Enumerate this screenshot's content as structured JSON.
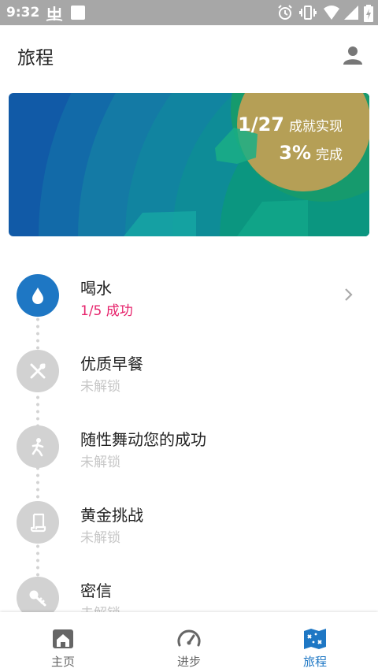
{
  "status_bar": {
    "time": "9:32"
  },
  "app_bar": {
    "title": "旅程"
  },
  "banner": {
    "achievements_count": "1/27",
    "achievements_label": "成就实现",
    "completion_percent": "3%",
    "completion_label": "完成"
  },
  "journey": {
    "items": [
      {
        "name": "喝水",
        "status": "1/5 成功",
        "icon": "water-drop-icon",
        "unlocked": true
      },
      {
        "name": "优质早餐",
        "status": "未解锁",
        "icon": "utensils-icon",
        "unlocked": false
      },
      {
        "name": "随性舞动您的成功",
        "status": "未解锁",
        "icon": "dance-icon",
        "unlocked": false
      },
      {
        "name": "黄金挑战",
        "status": "未解锁",
        "icon": "scroll-icon",
        "unlocked": false
      },
      {
        "name": "密信",
        "status": "未解锁",
        "icon": "key-icon",
        "unlocked": false
      }
    ]
  },
  "bottom_nav": {
    "home": "主页",
    "progress": "进步",
    "journey": "旅程",
    "active": "journey"
  },
  "colors": {
    "accent": "#1e77c4",
    "success_text": "#e6226b",
    "banner_gold": "#b59f56",
    "status_bar": "#a7a7a7"
  }
}
